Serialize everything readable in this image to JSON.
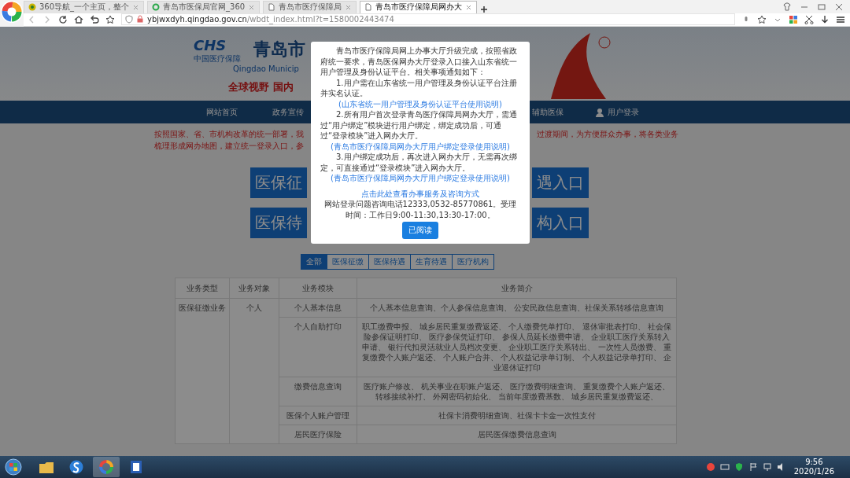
{
  "browser": {
    "tabs": [
      {
        "title": "360导航_一个主页，整个",
        "selected": false
      },
      {
        "title": "青岛市医保局官网_360",
        "selected": false
      },
      {
        "title": "青岛市医疗保障局",
        "selected": false
      },
      {
        "title": "青岛市医疗保障局网办大",
        "selected": true
      }
    ],
    "address": "**ybjwxdyh.qingdao.gov.cn**/wbdt_index.html?t=1580002443474"
  },
  "banner": {
    "logo": "CHS",
    "logo_caption": "中国医疗保障",
    "title": "青岛市",
    "subtitle": "Qingdao Municip",
    "slogan": "全球视野 国内"
  },
  "nav": {
    "left": [
      "网站首页",
      "政务宣传"
    ],
    "right": [
      {
        "label": "辅助医保",
        "kind": "text"
      },
      {
        "label": "用户登录",
        "kind": "user"
      }
    ]
  },
  "notice": {
    "left": [
      "按照国家、省、市机构改革的统一部署，我",
      "梳理形成网办地图，建立统一登录入口，参"
    ],
    "right": [
      "过渡期间，为方便群众办事，将各类业务"
    ]
  },
  "entries": [
    {
      "left": "医保征",
      "right": "遇入口"
    },
    {
      "left": "医保待",
      "right": "构入口"
    }
  ],
  "filters": [
    {
      "label": "全部",
      "selected": true
    },
    {
      "label": "医保征缴",
      "selected": false
    },
    {
      "label": "医保待遇",
      "selected": false
    },
    {
      "label": "生育待遇",
      "selected": false
    },
    {
      "label": "医疗机构",
      "selected": false
    }
  ],
  "table": {
    "columns": [
      "业务类型",
      "业务对象",
      "业务模块",
      "业务简介"
    ],
    "type": "医保征缴业务",
    "target": "个人",
    "rows": [
      {
        "module": "个人基本信息",
        "summary": "个人基本信息查询、个人参保信息查询、 公安民政信息查询、社保关系转移信息查询"
      },
      {
        "module": "个人自助打印",
        "summary": "职工缴费申报、 城乡居民重复缴费返还、 个人缴费凭单打印、 退休审批表打印、 社会保险参保证明打印、 医疗参保凭证打印、 参保人员延长缴费申请、 企业职工医疗关系转入申请、 银行代扣灵活就业人员档次变更、 企业职工医疗关系转出、 一次性人员缴费、 重复缴费个人账户返还、 个人账户合并、 个人权益记录单订制、 个人权益记录单打印、 企业退休证打印"
      },
      {
        "module": "缴费信息查询",
        "summary": "医疗账户修改、 机关事业在职账户返还、 医疗缴费明细查询、 重复缴费个人账户返还、转移接续补打、 外网密码初始化、 当前年度缴费基数、 城乡居民重复缴费返还、"
      },
      {
        "module": "医保个人账户管理",
        "summary": "社保卡消费明细查询、社保卡卡金一次性支付"
      },
      {
        "module": "居民医疗保险",
        "summary": "居民医保缴费信息查询"
      }
    ]
  },
  "modal": {
    "paragraphs": [
      {
        "kind": "text",
        "text": "青岛市医疗保障局网上办事大厅升级完成，按照省政府统一要求，青岛医保网办大厅登录入口接入山东省统一用户管理及身份认证平台。相关事项通知如下："
      },
      {
        "kind": "text",
        "text": "1.用户需在山东省统一用户管理及身份认证平台注册并实名认证。"
      },
      {
        "kind": "link",
        "text": "(山东省统一用户管理及身份认证平台使用说明)"
      },
      {
        "kind": "text",
        "text": "2.所有用户首次登录青岛医疗保障局网办大厅，需通过“用户绑定”模块进行用户绑定，绑定成功后，可通过“登录模块”进入网办大厅。"
      },
      {
        "kind": "link",
        "text": "(青岛市医疗保障局网办大厅用户绑定登录使用说明)"
      },
      {
        "kind": "text",
        "text": "3.用户绑定成功后，再次进入网办大厅，无需再次绑定，可直接通过“登录模块”进入网办大厅。"
      },
      {
        "kind": "link",
        "text": "(青岛市医疗保障局网办大厅用户绑定登录使用说明)"
      }
    ],
    "contact_link": "点击此处查看办事服务及咨询方式",
    "contact": "网站登录问题咨询电话12333,0532-85770861。受理时间：工作日9:00-11:30,13:30-17:00。",
    "button": "已阅读"
  },
  "taskbar": {
    "apps": [
      {
        "kind": "folder",
        "selected": false
      },
      {
        "kind": "s-browser",
        "selected": false
      },
      {
        "kind": "ring-browser",
        "selected": true
      },
      {
        "kind": "document",
        "selected": false
      }
    ],
    "time": "9:56",
    "date": "2020/1/26"
  }
}
